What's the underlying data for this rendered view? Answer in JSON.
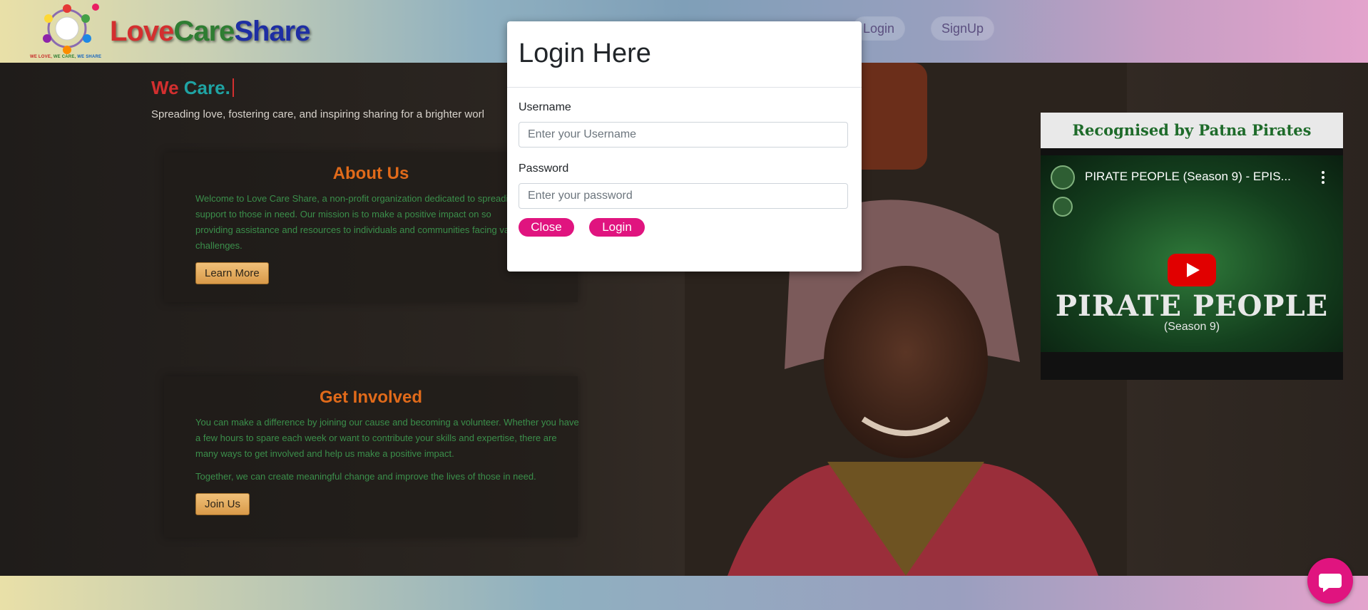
{
  "header": {
    "brand": {
      "love": "Love",
      "care": "Care",
      "share": "Share"
    },
    "tagline": {
      "love": "WE LOVE,",
      "care": "WE CARE,",
      "share": "WE SHARE"
    },
    "nav": {
      "login": "Login",
      "signup": "SignUp"
    }
  },
  "hero": {
    "title_we": "We",
    "title_care": "Care.",
    "subtitle": "Spreading love, fostering care, and inspiring sharing for a brighter worl"
  },
  "about": {
    "heading": "About Us",
    "text": "Welcome to Love Care Share, a non-profit organization dedicated to spreadi and support to those in need. Our mission is to make a positive impact on so providing assistance and resources to individuals and communities facing var challenges.",
    "button": "Learn More"
  },
  "involved": {
    "heading": "Get Involved",
    "text1": "You can make a difference by joining our cause and becoming a volunteer. Whether you have a few hours to spare each week or want to contribute your skills and expertise, there are many ways to get involved and help us make a positive impact.",
    "text2": "Together, we can create meaningful change and improve the lives of those in need.",
    "button": "Join Us"
  },
  "video": {
    "heading": "Recognised by Patna Pirates",
    "title": "PIRATE PEOPLE (Season 9) - EPIS...",
    "big_title": "PIRATE PEOPLE",
    "season": "(Season 9)"
  },
  "modal": {
    "title": "Login Here",
    "username_label": "Username",
    "username_placeholder": "Enter your Username",
    "password_label": "Password",
    "password_placeholder": "Enter your password",
    "close": "Close",
    "login": "Login"
  }
}
